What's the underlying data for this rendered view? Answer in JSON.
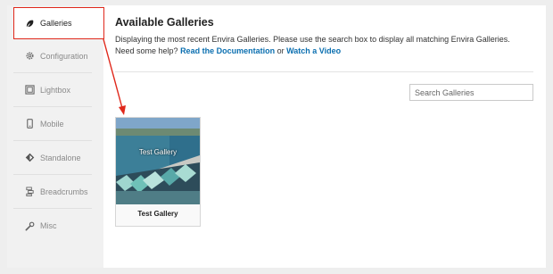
{
  "sidebar": {
    "items": [
      {
        "label": "Galleries",
        "icon": "leaf-icon"
      },
      {
        "label": "Configuration",
        "icon": "gear-icon"
      },
      {
        "label": "Lightbox",
        "icon": "lightbox-icon"
      },
      {
        "label": "Mobile",
        "icon": "mobile-icon"
      },
      {
        "label": "Standalone",
        "icon": "standalone-icon"
      },
      {
        "label": "Breadcrumbs",
        "icon": "breadcrumbs-icon"
      },
      {
        "label": "Misc",
        "icon": "wrench-icon"
      }
    ]
  },
  "main": {
    "title": "Available Galleries",
    "desc_line1": "Displaying the most recent Envira Galleries. Please use the search box to display all matching Envira Galleries.",
    "desc_help": "Need some help?",
    "doc_link": "Read the Documentation",
    "or_text": "or",
    "video_link": "Watch a Video",
    "search": {
      "placeholder": "Search Galleries"
    },
    "galleries": [
      {
        "name": "Test Gallery",
        "overlay": "Test Gallery"
      }
    ]
  },
  "colors": {
    "highlight": "#e0281b",
    "link": "#0b6fb0"
  }
}
